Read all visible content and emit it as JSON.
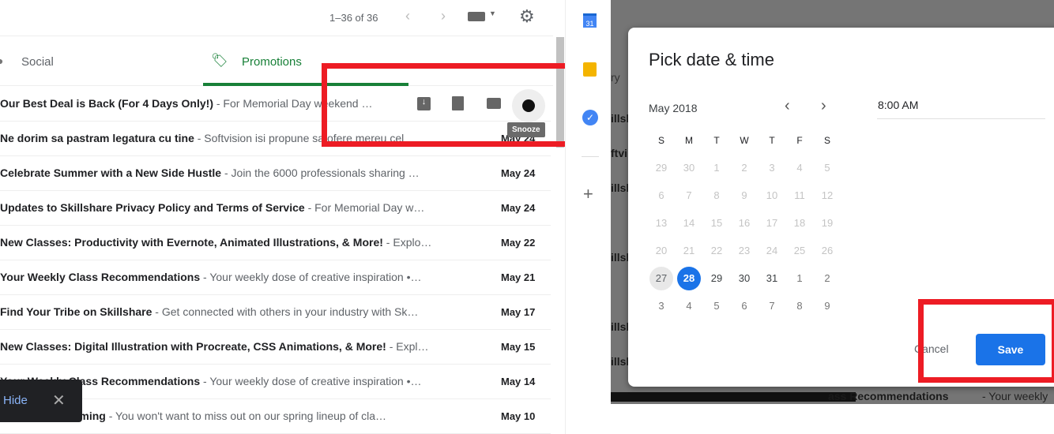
{
  "toolbar": {
    "count": "1–36 of 36",
    "prev_icon": "chevron-left-icon",
    "next_icon": "chevron-right-icon",
    "keyboard_icon": "keyboard-icon",
    "settings_icon": "gear-icon"
  },
  "tabs": [
    {
      "label": "Social",
      "icon": "people-icon"
    },
    {
      "label": "Promotions",
      "icon": "tag-icon",
      "active": true
    }
  ],
  "hover_actions": {
    "archive": "archive-icon",
    "delete": "trash-icon",
    "mark_read": "open-envelope-icon",
    "snooze": "clock-icon",
    "tooltip": "Snooze"
  },
  "emails": [
    {
      "subject": "Our Best Deal is Back (For 4 Days Only!)",
      "snippet": " - For Memorial Day weekend …",
      "date": ""
    },
    {
      "subject": "Ne dorim sa pastram legatura cu tine",
      "snippet": " - Softvision isi propune sa ofere mereu cel",
      "date": "May 24"
    },
    {
      "subject": "Celebrate Summer with a New Side Hustle",
      "snippet": " - Join the 6000 professionals sharing …",
      "date": "May 24"
    },
    {
      "subject": "Updates to Skillshare Privacy Policy and Terms of Service",
      "snippet": " - For Memorial Day w…",
      "date": "May 24"
    },
    {
      "subject": "New Classes: Productivity with Evernote, Animated Illustrations, & More!",
      "snippet": " - Explo…",
      "date": "May 22"
    },
    {
      "subject": "Your Weekly Class Recommendations",
      "snippet": " - Your weekly dose of creative inspiration •…",
      "date": "May 21"
    },
    {
      "subject": "Find Your Tribe on Skillshare",
      "snippet": " - Get connected with others in your industry with Sk…",
      "date": "May 17"
    },
    {
      "subject": "New Classes: Digital Illustration with Procreate, CSS Animations, & More!",
      "snippet": " - Expl…",
      "date": "May 15"
    },
    {
      "subject": "Your Weekly Class Recommendations",
      "snippet": " - Your weekly dose of creative inspiration •…",
      "date": "May 14"
    },
    {
      "subject": "Classes are Coming",
      "snippet": " - You won't want to miss out on our spring lineup of cla…",
      "date": "May 10"
    }
  ],
  "toast": {
    "action": "Hide",
    "close_icon": "close-icon"
  },
  "side_apps": [
    {
      "icon": "calendar-icon",
      "label": "31"
    },
    {
      "icon": "keep-bulb-icon"
    },
    {
      "icon": "tasks-icon"
    },
    {
      "icon": "plus-icon"
    }
  ],
  "background_fragments": [
    "ry",
    "illsh",
    "ftvi",
    "ass Recommendations",
    " - Your weekly"
  ],
  "dialog": {
    "title": "Pick date & time",
    "month": "May 2018",
    "time": "8:00 AM",
    "weekdays": [
      "S",
      "M",
      "T",
      "W",
      "T",
      "F",
      "S"
    ],
    "weeks": [
      [
        "29",
        "30",
        "1",
        "2",
        "3",
        "4",
        "5"
      ],
      [
        "6",
        "7",
        "8",
        "9",
        "10",
        "11",
        "12"
      ],
      [
        "13",
        "14",
        "15",
        "16",
        "17",
        "18",
        "19"
      ],
      [
        "20",
        "21",
        "22",
        "23",
        "24",
        "25",
        "26"
      ],
      [
        "27",
        "28",
        "29",
        "30",
        "31",
        "1",
        "2"
      ],
      [
        "3",
        "4",
        "5",
        "6",
        "7",
        "8",
        "9"
      ]
    ],
    "today": "27",
    "selected": "28",
    "cancel": "Cancel",
    "save": "Save",
    "colors": {
      "accent": "#1a73e8",
      "highlight": "#ed1c24"
    }
  }
}
